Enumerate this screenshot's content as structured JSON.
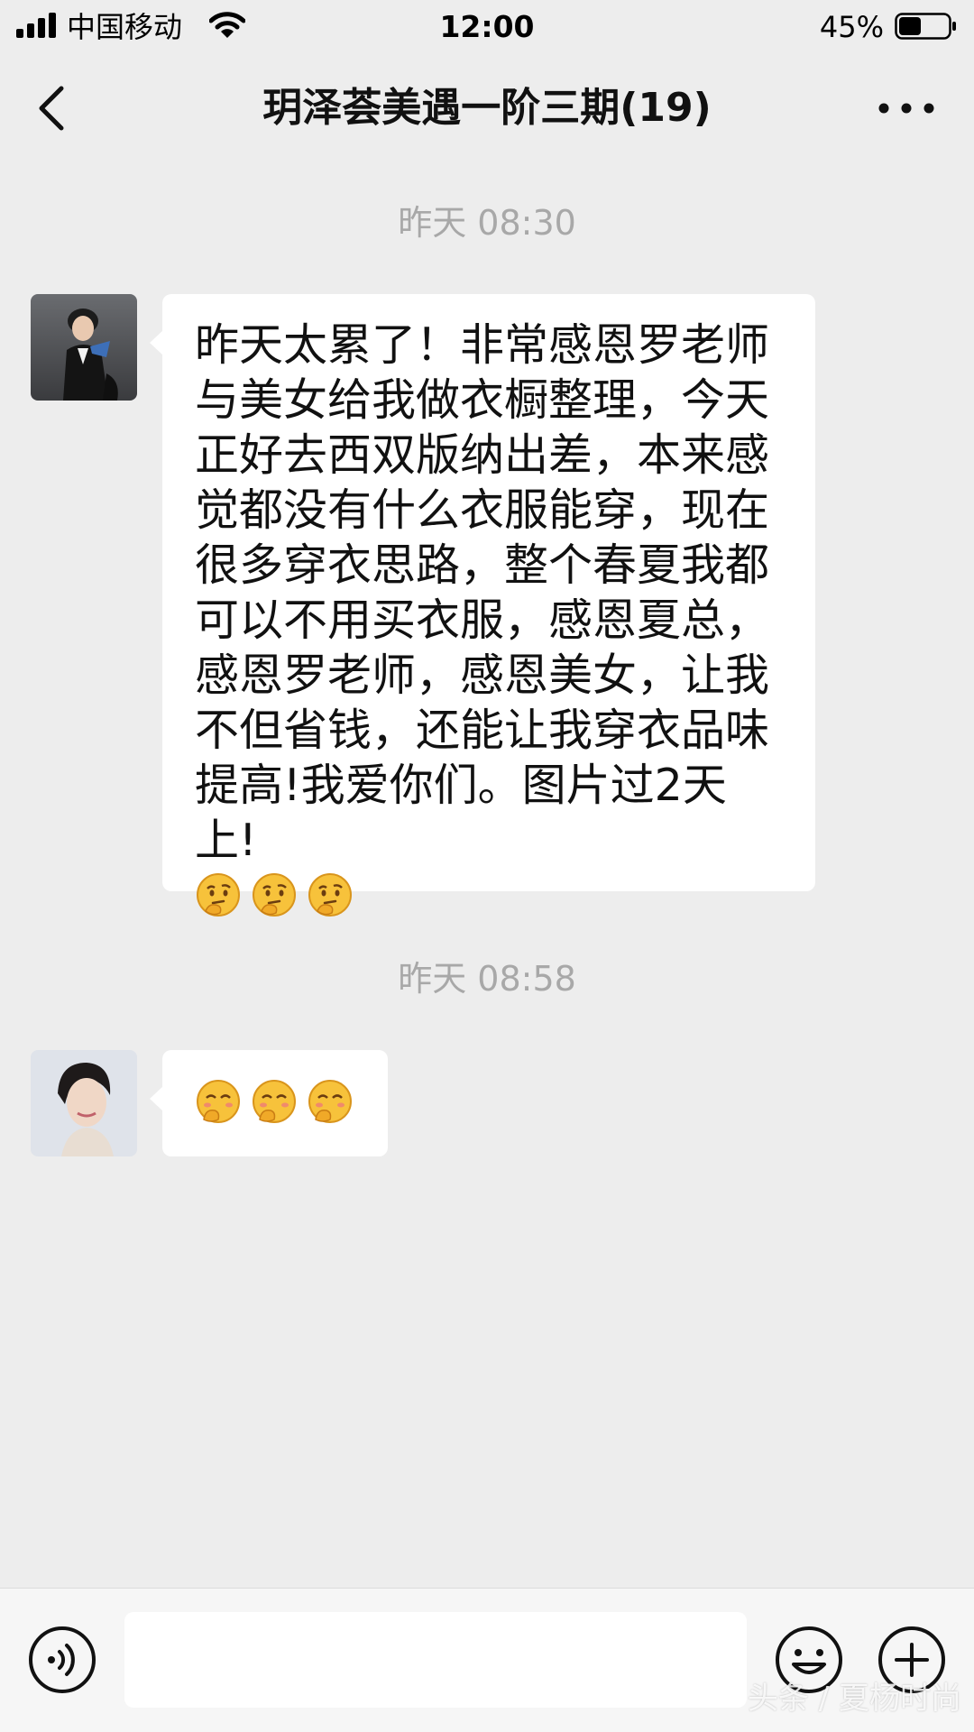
{
  "status_bar": {
    "carrier": "中国移动",
    "time": "12:00",
    "battery_percent": "45%",
    "battery_level": 0.45,
    "icons": [
      "signal-icon",
      "wifi-icon",
      "battery-icon"
    ]
  },
  "nav": {
    "title": "玥泽荟美遇一阶三期(19)",
    "icons": [
      "back-chevron-icon",
      "more-dots-icon"
    ]
  },
  "chat": {
    "messages": [
      {
        "timestamp": "昨天 08:30",
        "text": "昨天太累了！非常感恩罗老师\n与美女给我做衣橱整理，今天\n正好去西双版纳出差，本来感\n觉都没有什么衣服能穿，现在\n很多穿衣思路，整个春夏我都\n可以不用买衣服，感恩夏总，\n感恩罗老师，感恩美女，让我\n不但省钱，还能让我穿衣品味\n提高!我爱你们。图片过2天上!",
        "emojis": [
          "thinking-face-emoji",
          "thinking-face-emoji",
          "thinking-face-emoji"
        ]
      },
      {
        "timestamp": "昨天 08:58",
        "text": "",
        "emojis": [
          "smirk-face-emoji",
          "smirk-face-emoji",
          "smirk-face-emoji"
        ]
      }
    ]
  },
  "input_bar": {
    "placeholder": "",
    "icons": [
      "voice-icon",
      "emoji-icon",
      "plus-icon"
    ],
    "watermark": "头条 / 夏杨时尚"
  },
  "colors": {
    "background": "#ededed",
    "bubble": "#ffffff",
    "timestamp": "#a8a8a8",
    "input_bar": "#f6f6f6"
  }
}
